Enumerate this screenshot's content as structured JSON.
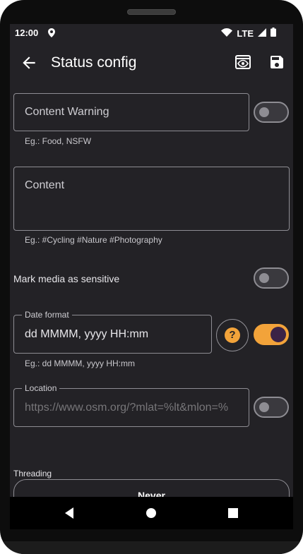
{
  "status_bar": {
    "time": "12:00",
    "network": "LTE",
    "icons": [
      "location-icon",
      "wifi-icon",
      "signal-icon",
      "battery-icon"
    ]
  },
  "app_bar": {
    "title": "Status config",
    "icons": [
      "back-arrow-icon",
      "preview-eye-icon",
      "save-disk-icon"
    ]
  },
  "content_warning": {
    "placeholder": "Content Warning",
    "helper": "Eg.: Food, NSFW",
    "enabled": false
  },
  "content": {
    "placeholder": "Content",
    "helper": "Eg.: #Cycling #Nature #Photography"
  },
  "sensitive": {
    "label": "Mark media as sensitive",
    "enabled": false
  },
  "date_format": {
    "label": "Date format",
    "value": "dd MMMM, yyyy HH:mm",
    "helper": "Eg.: dd MMMM, yyyy HH:mm",
    "help_glyph": "?",
    "enabled": true
  },
  "location": {
    "label": "Location",
    "placeholder": "https://www.osm.org/?mlat=%lt&mlon=%",
    "enabled": false
  },
  "threading": {
    "label": "Threading",
    "options": [
      "Never"
    ]
  },
  "colors": {
    "background": "#232226",
    "accent": "#f2a33a",
    "outline": "#8e8d93",
    "nav_bar": "#000000"
  },
  "nav_bar": {
    "icons": [
      "back-triangle-icon",
      "home-circle-icon",
      "recents-square-icon"
    ]
  }
}
